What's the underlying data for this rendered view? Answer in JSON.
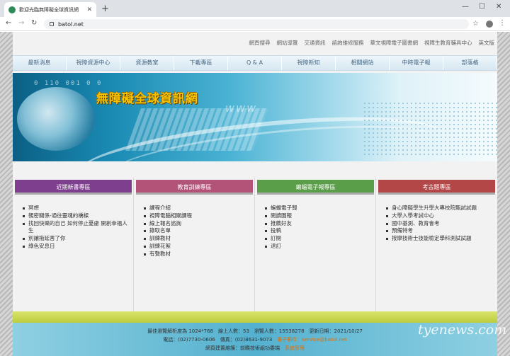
{
  "browser": {
    "tab_title": "歡迎光臨無障礙全球資訊網",
    "new_tab": "+",
    "url": "batol.net",
    "minimize": "—",
    "maximize": "☐",
    "close": "✕"
  },
  "toplinks": [
    "網頁搜尋",
    "網站導覽",
    "交通資訊",
    "諮詢維修服務",
    "華文視障電子圖書網",
    "視障生教育輔具中心",
    "英文版"
  ],
  "nav": [
    "最新消息",
    "視障資源中心",
    "資源教室",
    "下載專區",
    "Q & A",
    "視障新知",
    "相關網站",
    "中時電子報",
    "部落格"
  ],
  "banner": {
    "site_title": "無障礙全球資訊網",
    "binary": "0 110 001 0 0",
    "www": "www"
  },
  "columns": [
    {
      "title": "近期新書專區",
      "color": "#7e3f8f",
      "items": [
        "冥想",
        "親密關係-通往靈魂的橋樑",
        "找回快樂的自己 如何停止憂慮 開創幸福人生",
        "別讓拖延害了你",
        "綠色安息日"
      ]
    },
    {
      "title": "教育訓練專區",
      "color": "#b35378",
      "items": [
        "課程介紹",
        "視障電腦相關課程",
        "線上報名諮詢",
        "錄取名單",
        "訓練教材",
        "訓練花絮",
        "有聲教材"
      ]
    },
    {
      "title": "蝙蝠電子報專區",
      "color": "#5b9e4a",
      "items": [
        "蝙蝠電子報",
        "閱讀園報",
        "推薦好友",
        "投稿",
        "訂閱",
        "退訂"
      ]
    },
    {
      "title": "考古題專區",
      "color": "#b34747",
      "items": [
        "身心障礙學生升學大專校院甄試試題",
        "大學入學考試中心",
        "國中基測、教育會考",
        "預備特考",
        "按摩技術士技能檢定學科測試試題"
      ]
    }
  ],
  "footer": {
    "line1": "最佳瀏覽解析度為 1024*768　線上人數：53　瀏覽人數：15538278　更新日期：2021/10/27",
    "phone": "電話：(02)7730-0606　傳真：(02)8631-9073　",
    "email_label": "電子郵件：service@batol.net",
    "line3a": "網頁建置維護：前瞻技術組功委端　",
    "line3b": "系統管理"
  },
  "watermark": "tyenews.com"
}
